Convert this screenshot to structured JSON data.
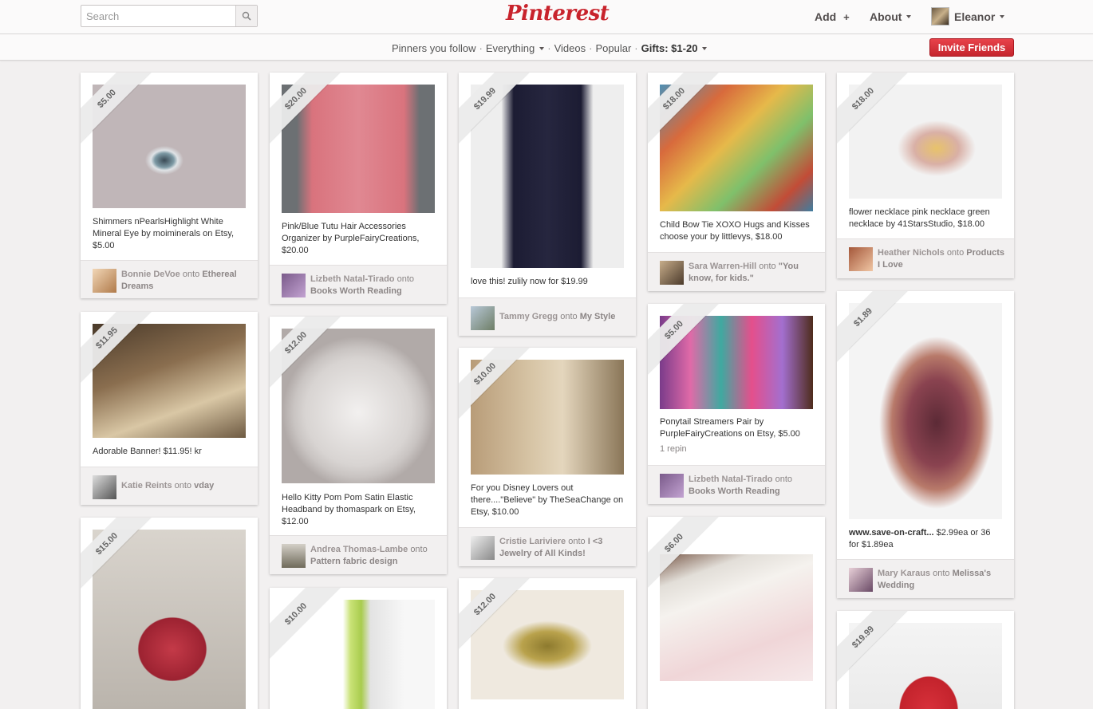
{
  "header": {
    "search_placeholder": "Search",
    "logo": "Pinterest",
    "add_label": "Add",
    "add_icon": "+",
    "about_label": "About",
    "user_name": "Eleanor"
  },
  "subnav": {
    "pinners_you_follow": "Pinners you follow",
    "everything": "Everything",
    "videos": "Videos",
    "popular": "Popular",
    "gifts": "Gifts: $1-20",
    "separator": "·",
    "invite_button": "Invite Friends"
  },
  "colors": {
    "brand_red": "#c8232c",
    "background": "#f2f0f0"
  },
  "onto": "onto",
  "pins": [
    {
      "price": "$5.00",
      "desc": "Shimmers nPearlsHighlight White Mineral Eye by moiminerals on Etsy, $5.00",
      "user": "Bonnie DeVoe",
      "board": "Ethereal Dreams"
    },
    {
      "price": "$11.95",
      "desc": "Adorable Banner! $11.95! kr",
      "user": "Katie Reints",
      "board": "vday"
    },
    {
      "price": "$15.00"
    },
    {
      "price": "$20.00",
      "desc": "Pink/Blue Tutu Hair Accessories Organizer by PurpleFairyCreations, $20.00",
      "user": "Lizbeth Natal-Tirado",
      "board": "Books Worth Reading"
    },
    {
      "price": "$12.00",
      "desc": "Hello Kitty Pom Pom Satin Elastic Headband by thomaspark on Etsy, $12.00",
      "user": "Andrea Thomas-Lambe",
      "board": "Pattern fabric design"
    },
    {
      "price": "$10.00"
    },
    {
      "price": "$19.99",
      "desc": "love this! zulily now for $19.99",
      "user": "Tammy Gregg",
      "board": "My Style"
    },
    {
      "price": "$10.00",
      "desc": "For you Disney Lovers out there....\"Believe\" by TheSeaChange on Etsy, $10.00",
      "user": "Cristie Lariviere",
      "board": "I <3 Jewelry of All Kinds!"
    },
    {
      "price": "$12.00"
    },
    {
      "price": "$18.00",
      "desc": "Child Bow Tie XOXO Hugs and Kisses choose your by littlevys, $18.00",
      "user": "Sara Warren-Hill",
      "board": "\"You know, for kids.\""
    },
    {
      "price": "$5.00",
      "desc": "Ponytail Streamers Pair by PurpleFairyCreations on Etsy, $5.00",
      "repins": "1 repin",
      "user": "Lizbeth Natal-Tirado",
      "board": "Books Worth Reading"
    },
    {
      "price": "$6.00"
    },
    {
      "price": "$18.00",
      "desc": "flower necklace pink necklace green necklace by 41StarsStudio, $18.00",
      "user": "Heather Nichols",
      "board": "Products I Love"
    },
    {
      "price": "$1.89",
      "desc_bold": "www.save-on-craft...",
      "desc": " $2.99ea or 36 for $1.89ea",
      "user": "Mary Karaus",
      "board": "Melissa's Wedding"
    },
    {
      "price": "$19.99"
    }
  ]
}
